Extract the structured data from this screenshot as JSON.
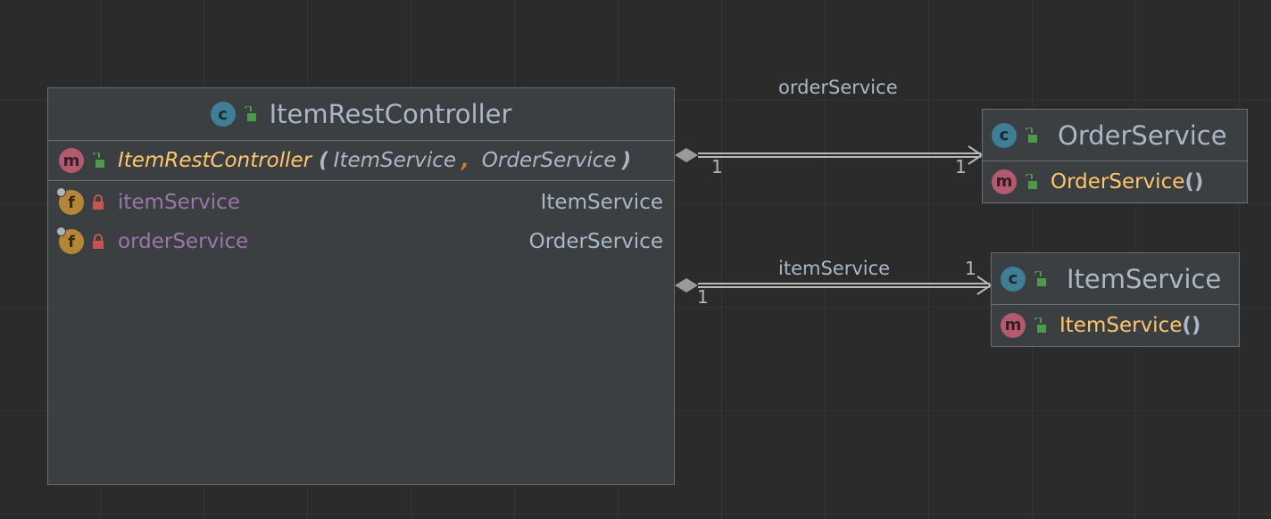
{
  "nodes": {
    "controller": {
      "title": "ItemRestController",
      "constructor": {
        "name": "ItemRestController",
        "open_paren": "(",
        "param1": "ItemService",
        "comma": ",",
        "param2": "OrderService",
        "close_paren": ")"
      },
      "fields": [
        {
          "name": "itemService",
          "type": "ItemService"
        },
        {
          "name": "orderService",
          "type": "OrderService"
        }
      ]
    },
    "order_service": {
      "title": "OrderService",
      "method": {
        "name": "OrderService",
        "parens": "()"
      }
    },
    "item_service": {
      "title": "ItemService",
      "method": {
        "name": "ItemService",
        "parens": "()"
      }
    }
  },
  "badges": {
    "class": "c",
    "method": "m",
    "field": "f"
  },
  "edges": [
    {
      "label": "orderService",
      "source_mult": "1",
      "target_mult": "1"
    },
    {
      "label": "itemService",
      "source_mult": "1",
      "target_mult": "1"
    }
  ],
  "icons": [
    "class-icon",
    "method-icon",
    "field-icon",
    "public-lock-icon",
    "private-lock-icon",
    "composition-diamond-icon",
    "arrow-head-icon"
  ]
}
